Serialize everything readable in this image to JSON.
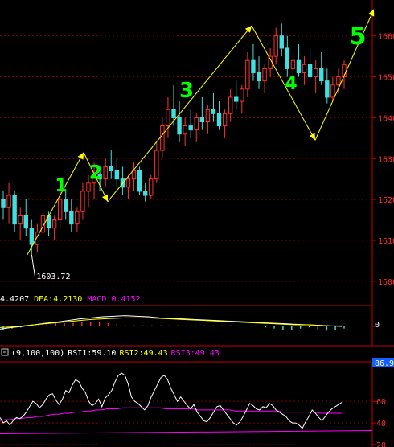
{
  "chart_data": [
    {
      "type": "candlestick",
      "panel": "price",
      "ylim": [
        1598,
        1668
      ],
      "y_ticks": [
        "1600",
        "1610",
        "1620",
        "1630",
        "1640",
        "1650",
        "1660"
      ],
      "low_annotation": "1603.72",
      "colors": {
        "up": "#ff3030",
        "down": "#40e0e0",
        "grid": "#7a0000",
        "axis": "#c00000",
        "trend": "#ffff00",
        "marks": "#00ff00"
      },
      "wave_labels": [
        "1",
        "2",
        "3",
        "4",
        "5"
      ],
      "wave_path_y": [
        1606.5,
        1631.5,
        1619.5,
        1662.5,
        1634.5,
        1666.5
      ],
      "candles": [
        [
          1620.0,
          1622.0,
          1615.0,
          1618.0
        ],
        [
          1618.0,
          1624.0,
          1614.0,
          1621.0
        ],
        [
          1621.0,
          1622.0,
          1612.0,
          1614.0
        ],
        [
          1614.0,
          1618.0,
          1610.0,
          1616.0
        ],
        [
          1616.0,
          1620.0,
          1611.0,
          1613.0
        ],
        [
          1613.0,
          1615.0,
          1606.5,
          1609.0
        ],
        [
          1609.0,
          1614.0,
          1607.0,
          1612.0
        ],
        [
          1612.0,
          1618.0,
          1609.0,
          1616.0
        ],
        [
          1616.0,
          1617.0,
          1611.0,
          1613.0
        ],
        [
          1613.0,
          1616.0,
          1610.0,
          1615.0
        ],
        [
          1615.0,
          1622.0,
          1613.0,
          1620.0
        ],
        [
          1620.0,
          1622.0,
          1615.0,
          1617.0
        ],
        [
          1617.0,
          1620.0,
          1612.0,
          1614.0
        ],
        [
          1614.0,
          1618.0,
          1612.0,
          1617.0
        ],
        [
          1617.0,
          1624.0,
          1615.0,
          1622.0
        ],
        [
          1622.0,
          1626.0,
          1618.0,
          1624.0
        ],
        [
          1624.0,
          1629.0,
          1620.0,
          1626.0
        ],
        [
          1626.0,
          1628.0,
          1622.0,
          1625.0
        ],
        [
          1625.0,
          1630.0,
          1623.0,
          1628.0
        ],
        [
          1628.0,
          1632.0,
          1625.0,
          1627.0
        ],
        [
          1627.0,
          1630.0,
          1623.0,
          1625.0
        ],
        [
          1625.0,
          1628.0,
          1621.0,
          1623.0
        ],
        [
          1623.0,
          1626.0,
          1620.0,
          1625.0
        ],
        [
          1625.0,
          1629.0,
          1622.0,
          1627.0
        ],
        [
          1627.0,
          1628.0,
          1621.0,
          1622.0
        ],
        [
          1622.0,
          1624.0,
          1619.5,
          1621.0
        ],
        [
          1621.0,
          1626.0,
          1620.0,
          1625.0
        ],
        [
          1625.0,
          1634.0,
          1624.0,
          1632.0
        ],
        [
          1632.0,
          1640.0,
          1630.0,
          1638.0
        ],
        [
          1638.0,
          1645.0,
          1635.0,
          1642.0
        ],
        [
          1642.0,
          1648.0,
          1638.0,
          1640.0
        ],
        [
          1640.0,
          1644.0,
          1634.0,
          1636.0
        ],
        [
          1636.0,
          1640.0,
          1633.0,
          1638.0
        ],
        [
          1638.0,
          1642.0,
          1635.0,
          1637.0
        ],
        [
          1637.0,
          1641.0,
          1634.0,
          1640.0
        ],
        [
          1640.0,
          1645.0,
          1637.0,
          1639.0
        ],
        [
          1639.0,
          1643.0,
          1636.0,
          1642.0
        ],
        [
          1642.0,
          1646.0,
          1639.0,
          1641.0
        ],
        [
          1641.0,
          1644.0,
          1637.0,
          1638.0
        ],
        [
          1638.0,
          1642.0,
          1635.0,
          1641.0
        ],
        [
          1641.0,
          1647.0,
          1639.0,
          1645.0
        ],
        [
          1645.0,
          1649.0,
          1642.0,
          1644.0
        ],
        [
          1644.0,
          1648.0,
          1641.0,
          1647.0
        ],
        [
          1647.0,
          1656.0,
          1645.0,
          1654.0
        ],
        [
          1654.0,
          1658.0,
          1649.0,
          1651.0
        ],
        [
          1651.0,
          1655.0,
          1647.0,
          1649.0
        ],
        [
          1649.0,
          1653.0,
          1646.0,
          1652.0
        ],
        [
          1652.0,
          1657.0,
          1650.0,
          1655.0
        ],
        [
          1655.0,
          1662.0,
          1653.0,
          1660.0
        ],
        [
          1660.0,
          1663.0,
          1655.0,
          1657.0
        ],
        [
          1657.0,
          1660.0,
          1650.0,
          1652.0
        ],
        [
          1652.0,
          1656.0,
          1647.0,
          1654.0
        ],
        [
          1654.0,
          1658.0,
          1650.0,
          1651.0
        ],
        [
          1651.0,
          1655.0,
          1648.0,
          1653.0
        ],
        [
          1653.0,
          1657.0,
          1649.0,
          1650.0
        ],
        [
          1650.0,
          1654.0,
          1646.0,
          1652.0
        ],
        [
          1652.0,
          1656.0,
          1648.0,
          1649.0
        ],
        [
          1649.0,
          1652.0,
          1643.5,
          1645.0
        ],
        [
          1645.0,
          1650.0,
          1644.0,
          1648.0
        ],
        [
          1648.0,
          1652.0,
          1646.0,
          1650.0
        ],
        [
          1650.0,
          1654.0,
          1647.0,
          1653.0
        ]
      ]
    },
    {
      "type": "macd",
      "panel": "macd",
      "ylim": [
        -3,
        3
      ],
      "zero_label": "0",
      "header": [
        {
          "text": "4.4207",
          "color": "#ffffff"
        },
        {
          "text": "DEA:4.2130",
          "color": "#ffff00"
        },
        {
          "text": "MACD:0.4152",
          "color": "#ff00ff"
        }
      ],
      "dif": [
        -0.5,
        -0.2,
        0.0,
        0.3,
        0.6,
        0.8,
        1.1,
        1.4,
        1.6,
        1.8,
        1.9,
        2.0,
        1.9,
        1.8,
        1.6,
        1.5,
        1.4,
        1.3,
        1.2,
        1.1,
        1.0,
        0.9,
        0.8,
        0.7,
        0.6,
        0.5,
        0.4,
        0.3,
        0.2,
        0.1,
        0.0
      ],
      "dea": [
        -0.2,
        -0.1,
        0.1,
        0.3,
        0.5,
        0.7,
        0.9,
        1.1,
        1.3,
        1.4,
        1.5,
        1.6,
        1.6,
        1.6,
        1.5,
        1.4,
        1.3,
        1.2,
        1.1,
        1.0,
        0.9,
        0.8,
        0.7,
        0.6,
        0.5,
        0.4,
        0.3,
        0.3,
        0.2,
        0.1,
        0.1
      ],
      "bars": [
        -0.6,
        -0.4,
        -0.2,
        0.0,
        0.2,
        0.4,
        0.6,
        0.6,
        0.6,
        0.8,
        0.8,
        0.8,
        0.6,
        0.4,
        0.2,
        0.2,
        0.2,
        0.2,
        0.2,
        0.2,
        0.2,
        0.2,
        0.2,
        0.2,
        0.2,
        0.2,
        0.2,
        0.0,
        0.0,
        0.0,
        -0.2,
        -0.4,
        -0.6,
        -0.6,
        -0.4,
        -0.2,
        -0.6,
        -0.8,
        -0.6,
        -0.4
      ]
    },
    {
      "type": "rsi",
      "panel": "rsi",
      "ylim": [
        20,
        95
      ],
      "y_ticks": [
        "20",
        "40",
        "60"
      ],
      "current_value": "86.9",
      "header": [
        {
          "text": "(9,100,100)",
          "color": "#ffffff"
        },
        {
          "text": "RSI1:59.10",
          "color": "#ffffff"
        },
        {
          "text": "RSI2:49.43",
          "color": "#ffff00"
        },
        {
          "text": "RSI3:49.43",
          "color": "#ff00ff"
        }
      ],
      "rsi1": [
        45,
        40,
        42,
        38,
        42,
        45,
        44,
        46,
        50,
        55,
        60,
        58,
        54,
        57,
        62,
        66,
        67,
        61,
        57,
        62,
        70,
        68,
        75,
        80,
        78,
        72,
        68,
        60,
        56,
        58,
        62,
        55,
        63,
        66,
        70,
        78,
        84,
        86,
        84,
        76,
        64,
        60,
        58,
        55,
        52,
        56,
        64,
        70,
        76,
        82,
        84,
        80,
        72,
        66,
        60,
        64,
        60,
        56,
        53,
        57,
        50,
        46,
        42,
        41,
        45,
        50,
        55,
        56,
        52,
        48,
        44,
        40,
        38,
        41,
        46,
        52,
        58,
        56,
        53,
        52,
        55,
        54,
        58,
        56,
        52,
        50,
        48,
        46,
        42,
        40,
        40,
        38,
        35,
        41,
        46,
        52,
        49,
        45,
        42,
        46,
        50,
        53,
        55,
        57,
        59
      ],
      "rsi2": [
        42,
        43,
        43,
        44,
        44,
        45,
        45,
        46,
        46,
        47,
        48,
        48,
        49,
        49,
        50,
        50,
        51,
        51,
        52,
        52,
        53,
        53,
        53,
        54,
        54,
        54,
        54,
        54,
        54,
        54,
        54,
        53,
        53,
        53,
        53,
        53,
        53,
        52,
        52,
        52,
        52,
        52,
        52,
        52,
        51,
        51,
        51,
        51,
        51,
        51,
        51,
        51,
        51,
        50,
        50,
        50,
        50,
        50,
        50,
        50,
        49,
        49,
        49,
        49,
        49
      ],
      "rsi3_line": [
        30,
        33
      ]
    }
  ]
}
